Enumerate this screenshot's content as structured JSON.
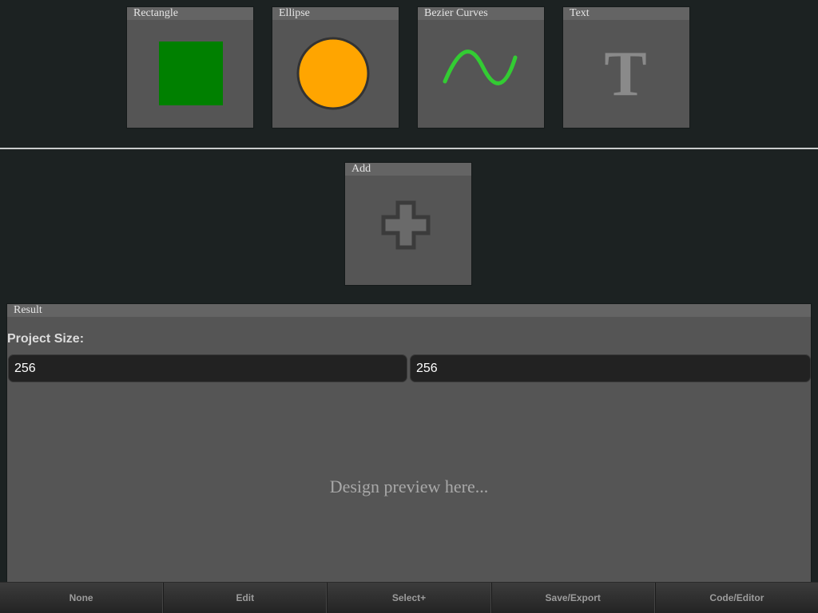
{
  "tools": {
    "rectangle": {
      "label": "Rectangle",
      "fill": "#008000"
    },
    "ellipse": {
      "label": "Ellipse",
      "fill": "#ffa500",
      "stroke": "#333333"
    },
    "bezier": {
      "label": "Bezier Curves",
      "stroke": "#33cc33"
    },
    "text": {
      "label": "Text",
      "glyph": "T",
      "color": "#8a8a8a"
    }
  },
  "add": {
    "label": "Add",
    "icon": "plus-icon"
  },
  "result": {
    "title": "Result",
    "project_size_label": "Project Size:",
    "width_value": "256",
    "height_value": "256",
    "preview_text": "Design preview here..."
  },
  "bottom_bar": {
    "none": "None",
    "edit": "Edit",
    "select_plus": "Select+",
    "save_export": "Save/Export",
    "code_editor": "Code/Editor"
  }
}
